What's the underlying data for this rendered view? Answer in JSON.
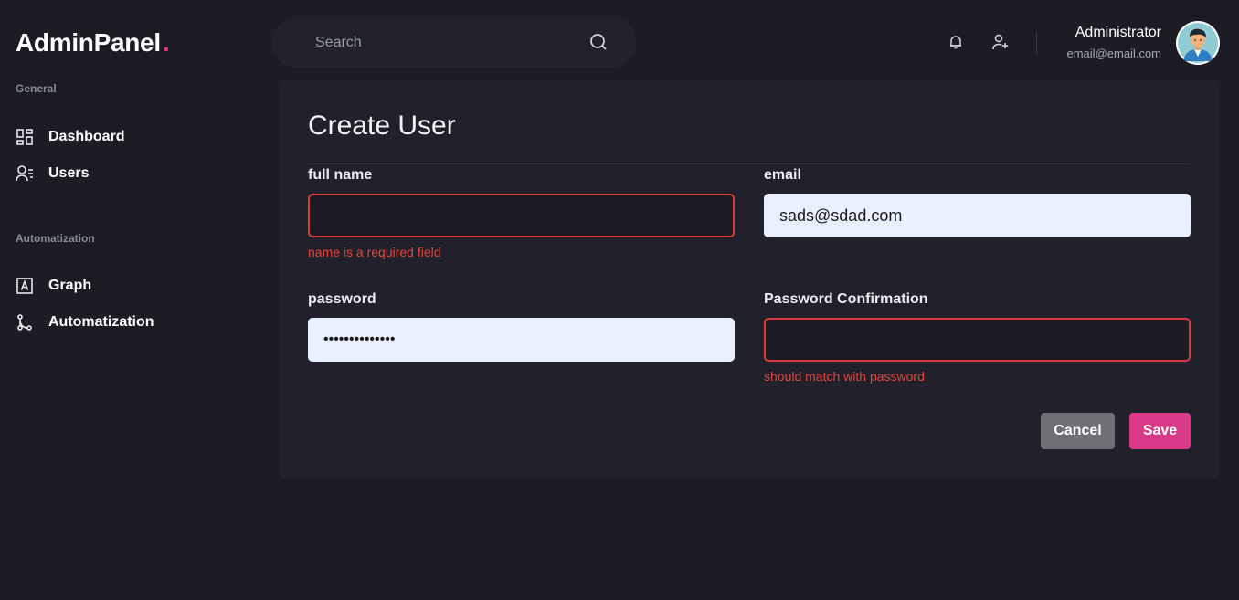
{
  "brand": {
    "name": "AdminPanel",
    "dot": ".",
    "accent_color": "#e0377f"
  },
  "sidebar": {
    "sections": [
      {
        "label": "General",
        "items": [
          {
            "label": "Dashboard",
            "icon": "dashboard-icon"
          },
          {
            "label": "Users",
            "icon": "users-icon"
          }
        ]
      },
      {
        "label": "Automatization",
        "items": [
          {
            "label": "Graph",
            "icon": "graph-icon"
          },
          {
            "label": "Automatization",
            "icon": "automatization-icon"
          }
        ]
      }
    ]
  },
  "header": {
    "search": {
      "placeholder": "Search",
      "value": "",
      "icon": "search-icon"
    },
    "icons": [
      "bell-icon",
      "add-user-icon"
    ],
    "user": {
      "name": "Administrator",
      "email": "email@email.com",
      "avatar": "avatar"
    }
  },
  "form": {
    "title": "Create User",
    "full_name": {
      "label": "full name",
      "value": "",
      "error": "name is a required field"
    },
    "email": {
      "label": "email",
      "value": "sads@sdad.com"
    },
    "password": {
      "label": "password",
      "value": "••••••••••••••"
    },
    "password_confirmation": {
      "label": "Password Confirmation",
      "value": "",
      "error": "should match with password"
    },
    "cancel_label": "Cancel",
    "save_label": "Save"
  },
  "colors": {
    "background": "#1b1c24",
    "card": "#21212b",
    "error": "#d63a3a",
    "save": "#d83a87",
    "cancel": "#6f6f75",
    "filled_input": "#e8f0fe"
  }
}
